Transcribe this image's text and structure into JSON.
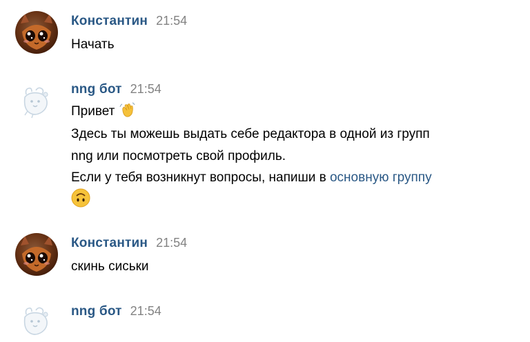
{
  "messages": [
    {
      "author": "Константин",
      "time": "21:54",
      "lines": [
        "Начать"
      ],
      "avatar": "user-avatar"
    },
    {
      "author": "nng бот",
      "time": "21:54",
      "greeting": "Привет",
      "greeting_emoji": "waving-hand",
      "line2": "Здесь ты можешь выдать себе редактора в одной из групп",
      "line3": "nng или посмотреть свой профиль.",
      "line4_prefix": "Если у тебя возникнут вопросы, напиши в",
      "line4_link": "основную группу",
      "trailing_emoji": "upside-down-face",
      "avatar": "bot-avatar"
    },
    {
      "author": "Константин",
      "time": "21:54",
      "lines": [
        "скинь сиськи"
      ],
      "avatar": "user-avatar"
    },
    {
      "author": "nng бот",
      "time": "21:54",
      "avatar": "bot-avatar"
    }
  ],
  "colors": {
    "author": "#2a5885",
    "time": "#828282",
    "link": "#2a5885",
    "text": "#000000"
  }
}
